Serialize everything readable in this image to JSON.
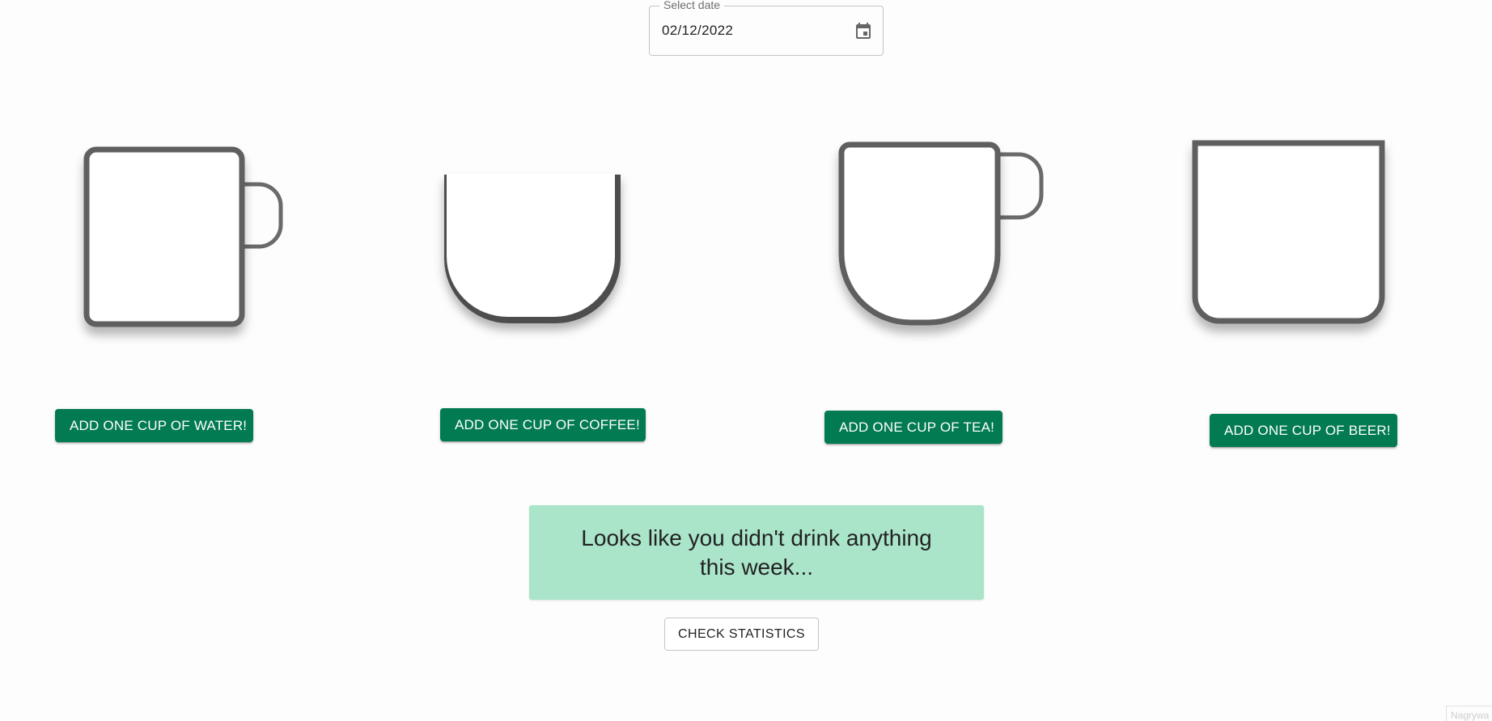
{
  "date_picker": {
    "label": "Select date",
    "value": "02/12/2022",
    "icon": "calendar-icon"
  },
  "cups": [
    {
      "drink": "water",
      "icon": "mug-icon"
    },
    {
      "drink": "coffee",
      "icon": "coffee-cup-icon"
    },
    {
      "drink": "tea",
      "icon": "tea-mug-icon"
    },
    {
      "drink": "beer",
      "icon": "beer-glass-icon"
    }
  ],
  "buttons": {
    "water": "ADD ONE CUP OF WATER!",
    "coffee": "ADD ONE CUP OF COFFEE!",
    "tea": "ADD ONE CUP OF TEA!",
    "beer": "ADD ONE CUP OF BEER!"
  },
  "message": {
    "text": "Looks like you didn't drink anything this week..."
  },
  "stats_button": {
    "label": "CHECK STATISTICS"
  },
  "corner_widget": {
    "text": "Nagrywa"
  },
  "colors": {
    "button_green": "#027a52",
    "message_bg": "#aae5ca",
    "cup_outline": "#5f5f5f"
  }
}
